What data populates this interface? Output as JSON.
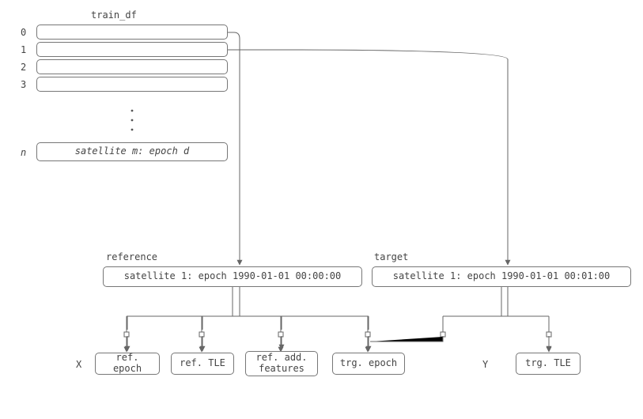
{
  "title": "train_df",
  "rows": {
    "idx": [
      "0",
      "1",
      "2",
      "3"
    ],
    "n_label": "n",
    "last_row": "satellite m: epoch d"
  },
  "mid": {
    "ref_label": "reference",
    "ref_box": "satellite 1: epoch 1990-01-01 00:00:00",
    "trg_label": "target",
    "trg_box": "satellite 1: epoch 1990-01-01 00:01:00"
  },
  "bottom": {
    "x_label": "X",
    "y_label": "Y",
    "ref_epoch": "ref. epoch",
    "ref_tle": "ref. TLE",
    "ref_add": "ref. add.\nfeatures",
    "trg_epoch": "trg. epoch",
    "trg_tle": "trg. TLE"
  }
}
